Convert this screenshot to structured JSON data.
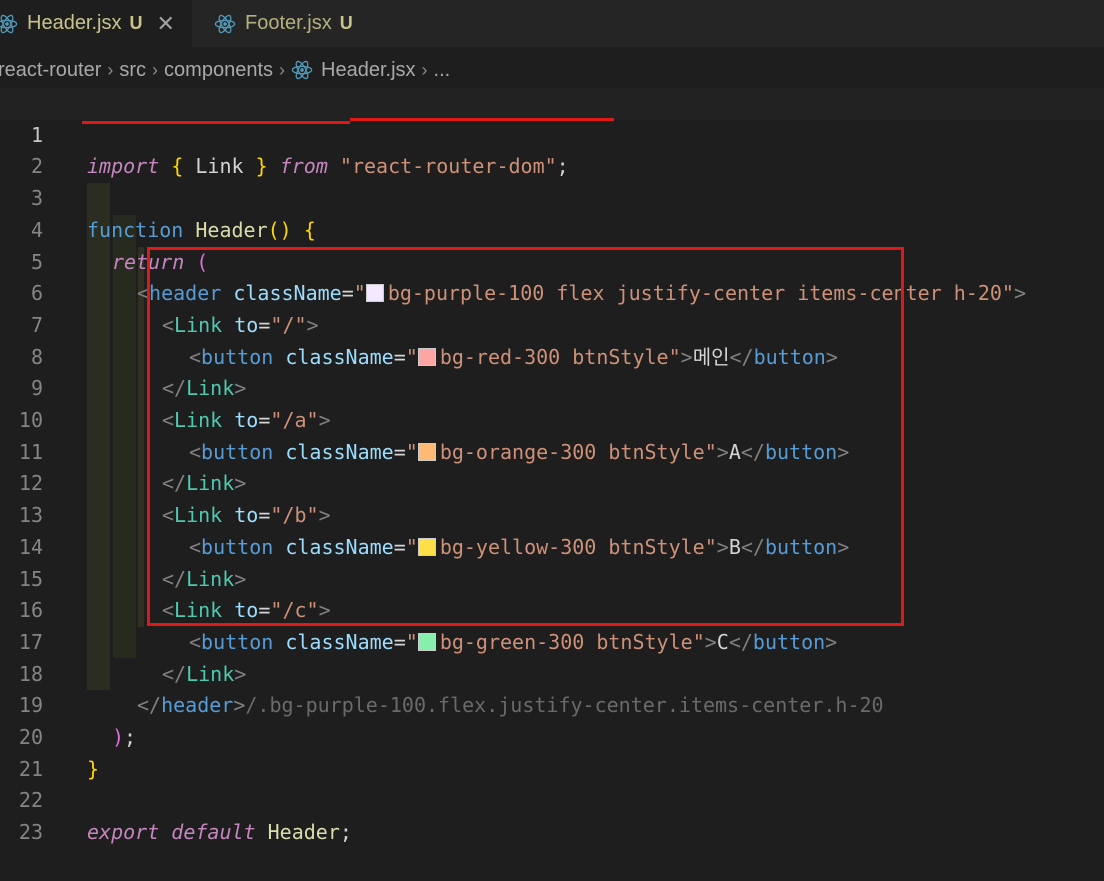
{
  "tabs": [
    {
      "filename": "Header.jsx",
      "status": "U",
      "active": true,
      "icon": "react-icon"
    },
    {
      "filename": "Footer.jsx",
      "status": "U",
      "active": false,
      "icon": "react-icon"
    }
  ],
  "breadcrumb": [
    "react-router",
    "src",
    "components",
    "Header.jsx",
    "..."
  ],
  "swatch_colors": {
    "purple": "#f3e8ff",
    "red": "#fca5a5",
    "orange": "#fdba74",
    "yellow": "#fde047",
    "green": "#86efac"
  },
  "annotation_color": "#e01818",
  "code": {
    "l1": {
      "import": "import",
      "brace_open": "{",
      "link": "Link",
      "brace_close": "}",
      "from": "from",
      "module": "\"react-router-dom\"",
      "semi": ";"
    },
    "l3": {
      "function": "function",
      "name": "Header",
      "parens": "()",
      "brace": "{"
    },
    "l4": {
      "return": "return",
      "paren": "("
    },
    "l5": {
      "open": "<",
      "tag": "header",
      "attr": "className",
      "eq": "=",
      "q1": "\"",
      "value": "bg-purple-100 flex justify-center items-center h-20",
      "q2": "\"",
      "close": ">"
    },
    "l6": {
      "open": "<",
      "tag": "Link",
      "attr": "to",
      "eq": "=",
      "value": "\"/\"",
      "close": ">"
    },
    "l7": {
      "open": "<",
      "tag": "button",
      "attr": "className",
      "eq": "=",
      "q1": "\"",
      "value": "bg-red-300 btnStyle",
      "q2": "\"",
      "close": ">",
      "text": "메인",
      "end_open": "</",
      "end_tag": "button",
      "end_close": ">"
    },
    "l8": {
      "open": "</",
      "tag": "Link",
      "close": ">"
    },
    "l9": {
      "open": "<",
      "tag": "Link",
      "attr": "to",
      "eq": "=",
      "value": "\"/a\"",
      "close": ">"
    },
    "l10": {
      "open": "<",
      "tag": "button",
      "attr": "className",
      "eq": "=",
      "q1": "\"",
      "value": "bg-orange-300 btnStyle",
      "q2": "\"",
      "close": ">",
      "text": "A",
      "end_open": "</",
      "end_tag": "button",
      "end_close": ">"
    },
    "l11": {
      "open": "</",
      "tag": "Link",
      "close": ">"
    },
    "l12": {
      "open": "<",
      "tag": "Link",
      "attr": "to",
      "eq": "=",
      "value": "\"/b\"",
      "close": ">"
    },
    "l13": {
      "open": "<",
      "tag": "button",
      "attr": "className",
      "eq": "=",
      "q1": "\"",
      "value": "bg-yellow-300 btnStyle",
      "q2": "\"",
      "close": ">",
      "text": "B",
      "end_open": "</",
      "end_tag": "button",
      "end_close": ">"
    },
    "l14": {
      "open": "</",
      "tag": "Link",
      "close": ">"
    },
    "l15": {
      "open": "<",
      "tag": "Link",
      "attr": "to",
      "eq": "=",
      "value": "\"/c\"",
      "close": ">"
    },
    "l16": {
      "open": "<",
      "tag": "button",
      "attr": "className",
      "eq": "=",
      "q1": "\"",
      "value": "bg-green-300 btnStyle",
      "q2": "\"",
      "close": ">",
      "text": "C",
      "end_open": "</",
      "end_tag": "button",
      "end_close": ">"
    },
    "l17": {
      "open": "</",
      "tag": "Link",
      "close": ">"
    },
    "l18": {
      "open": "</",
      "tag": "header",
      "close": ">",
      "ghost": "/.bg-purple-100.flex.justify-center.items-center.h-20"
    },
    "l19": {
      "paren": ")",
      "semi": ";"
    },
    "l20": {
      "brace": "}"
    },
    "l22": {
      "export": "export",
      "default": "default",
      "name": "Header",
      "semi": ";"
    }
  },
  "line_numbers": [
    "1",
    "2",
    "3",
    "4",
    "5",
    "6",
    "7",
    "8",
    "9",
    "10",
    "11",
    "12",
    "13",
    "14",
    "15",
    "16",
    "17",
    "18",
    "19",
    "20",
    "21",
    "22",
    "23"
  ]
}
